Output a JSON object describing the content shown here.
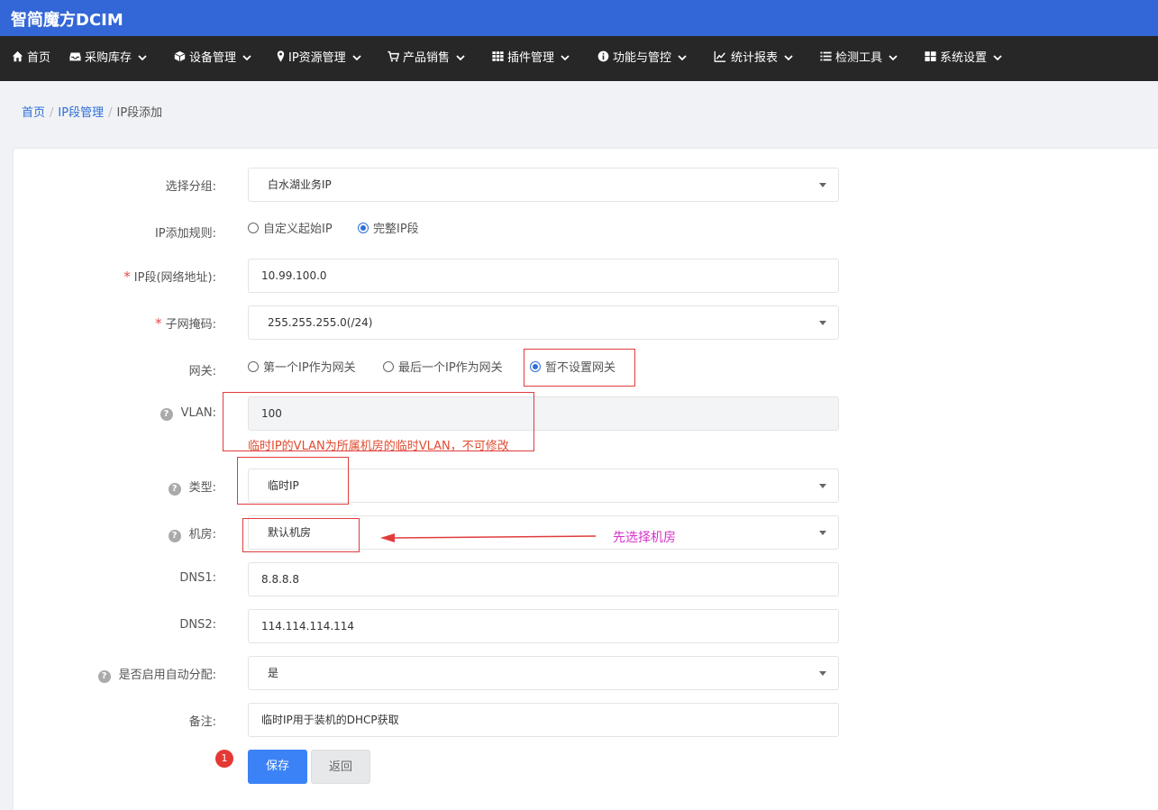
{
  "app": {
    "brand": "智简魔方DCIM"
  },
  "nav": [
    {
      "label": "首页",
      "icon": "home-icon",
      "dropdown": false
    },
    {
      "label": "采购库存",
      "icon": "inbox-icon",
      "dropdown": true
    },
    {
      "label": "设备管理",
      "icon": "cube-icon",
      "dropdown": true
    },
    {
      "label": "IP资源管理",
      "icon": "map-marker-icon",
      "dropdown": true
    },
    {
      "label": "产品销售",
      "icon": "cart-icon",
      "dropdown": true
    },
    {
      "label": "插件管理",
      "icon": "grid-icon",
      "dropdown": true
    },
    {
      "label": "功能与管控",
      "icon": "info-icon",
      "dropdown": true
    },
    {
      "label": "统计报表",
      "icon": "chart-icon",
      "dropdown": true
    },
    {
      "label": "检测工具",
      "icon": "list-icon",
      "dropdown": true
    },
    {
      "label": "系统设置",
      "icon": "windows-icon",
      "dropdown": true
    }
  ],
  "breadcrumb": {
    "home": "首页",
    "section": "IP段管理",
    "current": "IP段添加"
  },
  "form": {
    "group": {
      "label": "选择分组:",
      "value": "白水湖业务IP"
    },
    "rule": {
      "label": "IP添加规则:",
      "options": [
        "自定义起始IP",
        "完整IP段"
      ],
      "selected": 1
    },
    "network": {
      "label": "IP段(网络地址):",
      "value": "10.99.100.0"
    },
    "mask": {
      "label": "子网掩码:",
      "value": "255.255.255.0(/24)"
    },
    "gateway": {
      "label": "网关:",
      "options": [
        "第一个IP作为网关",
        "最后一个IP作为网关",
        "暂不设置网关"
      ],
      "selected": 2
    },
    "vlan": {
      "label": "VLAN:",
      "value": "100",
      "hint": "临时IP的VLAN为所属机房的临时VLAN，不可修改"
    },
    "type": {
      "label": "类型:",
      "value": "临时IP"
    },
    "room": {
      "label": "机房:",
      "value": "默认机房"
    },
    "dns1": {
      "label": "DNS1:",
      "value": "8.8.8.8"
    },
    "dns2": {
      "label": "DNS2:",
      "value": "114.114.114.114"
    },
    "auto_assign": {
      "label": "是否启用自动分配:",
      "value": "是"
    },
    "remark": {
      "label": "备注:",
      "value": "临时IP用于装机的DHCP获取"
    },
    "required_mark": "*",
    "help_mark": "?"
  },
  "buttons": {
    "save": "保存",
    "back": "返回",
    "badge": "1"
  },
  "annotation": {
    "text": "先选择机房"
  }
}
